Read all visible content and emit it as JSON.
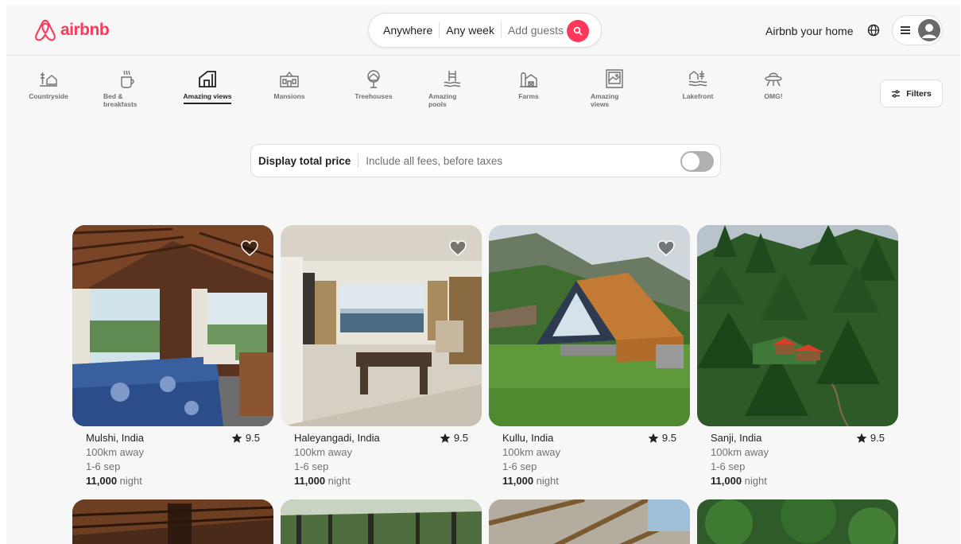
{
  "header": {
    "logo_text": "airbnb",
    "search": {
      "where": "Anywhere",
      "when": "Any week",
      "guests": "Add guests"
    },
    "host_link": "Airbnb your home"
  },
  "categories": [
    {
      "label": "Countryside",
      "icon": "countryside-icon"
    },
    {
      "label": "Bed & breakfasts",
      "icon": "coffee-mug-icon"
    },
    {
      "label": "Amazing views",
      "icon": "house-view-icon",
      "active": true
    },
    {
      "label": "Mansions",
      "icon": "mansion-icon"
    },
    {
      "label": "Treehouses",
      "icon": "treehouse-icon"
    },
    {
      "label": "Amazing pools",
      "icon": "pool-icon"
    },
    {
      "label": "Farms",
      "icon": "farm-icon"
    },
    {
      "label": "Amazing views",
      "icon": "picture-frame-icon"
    },
    {
      "label": "Lakefront",
      "icon": "lakefront-icon"
    },
    {
      "label": "OMG!",
      "icon": "ufo-icon"
    }
  ],
  "filters_label": "Filters",
  "price_toggle": {
    "title": "Display total price",
    "subtitle": "Include all fees, before taxes",
    "enabled": false
  },
  "listings": [
    {
      "location": "Mulshi, India",
      "rating": "9.5",
      "distance": "100km away",
      "dates": "1-6 sep",
      "price": "11,000",
      "price_unit": "night"
    },
    {
      "location": "Haleyangadi, India",
      "rating": "9.5",
      "distance": "100km away",
      "dates": "1-6 sep",
      "price": "11,000",
      "price_unit": "night"
    },
    {
      "location": "Kullu, India",
      "rating": "9.5",
      "distance": "100km away",
      "dates": "1-6 sep",
      "price": "11,000",
      "price_unit": "night"
    },
    {
      "location": "Sanji, India",
      "rating": "9.5",
      "distance": "100km away",
      "dates": "1-6 sep",
      "price": "11,000",
      "price_unit": "night"
    }
  ],
  "colors": {
    "brand": "#ff385c",
    "text": "#222222",
    "muted": "#717171",
    "border": "#dddddd"
  }
}
